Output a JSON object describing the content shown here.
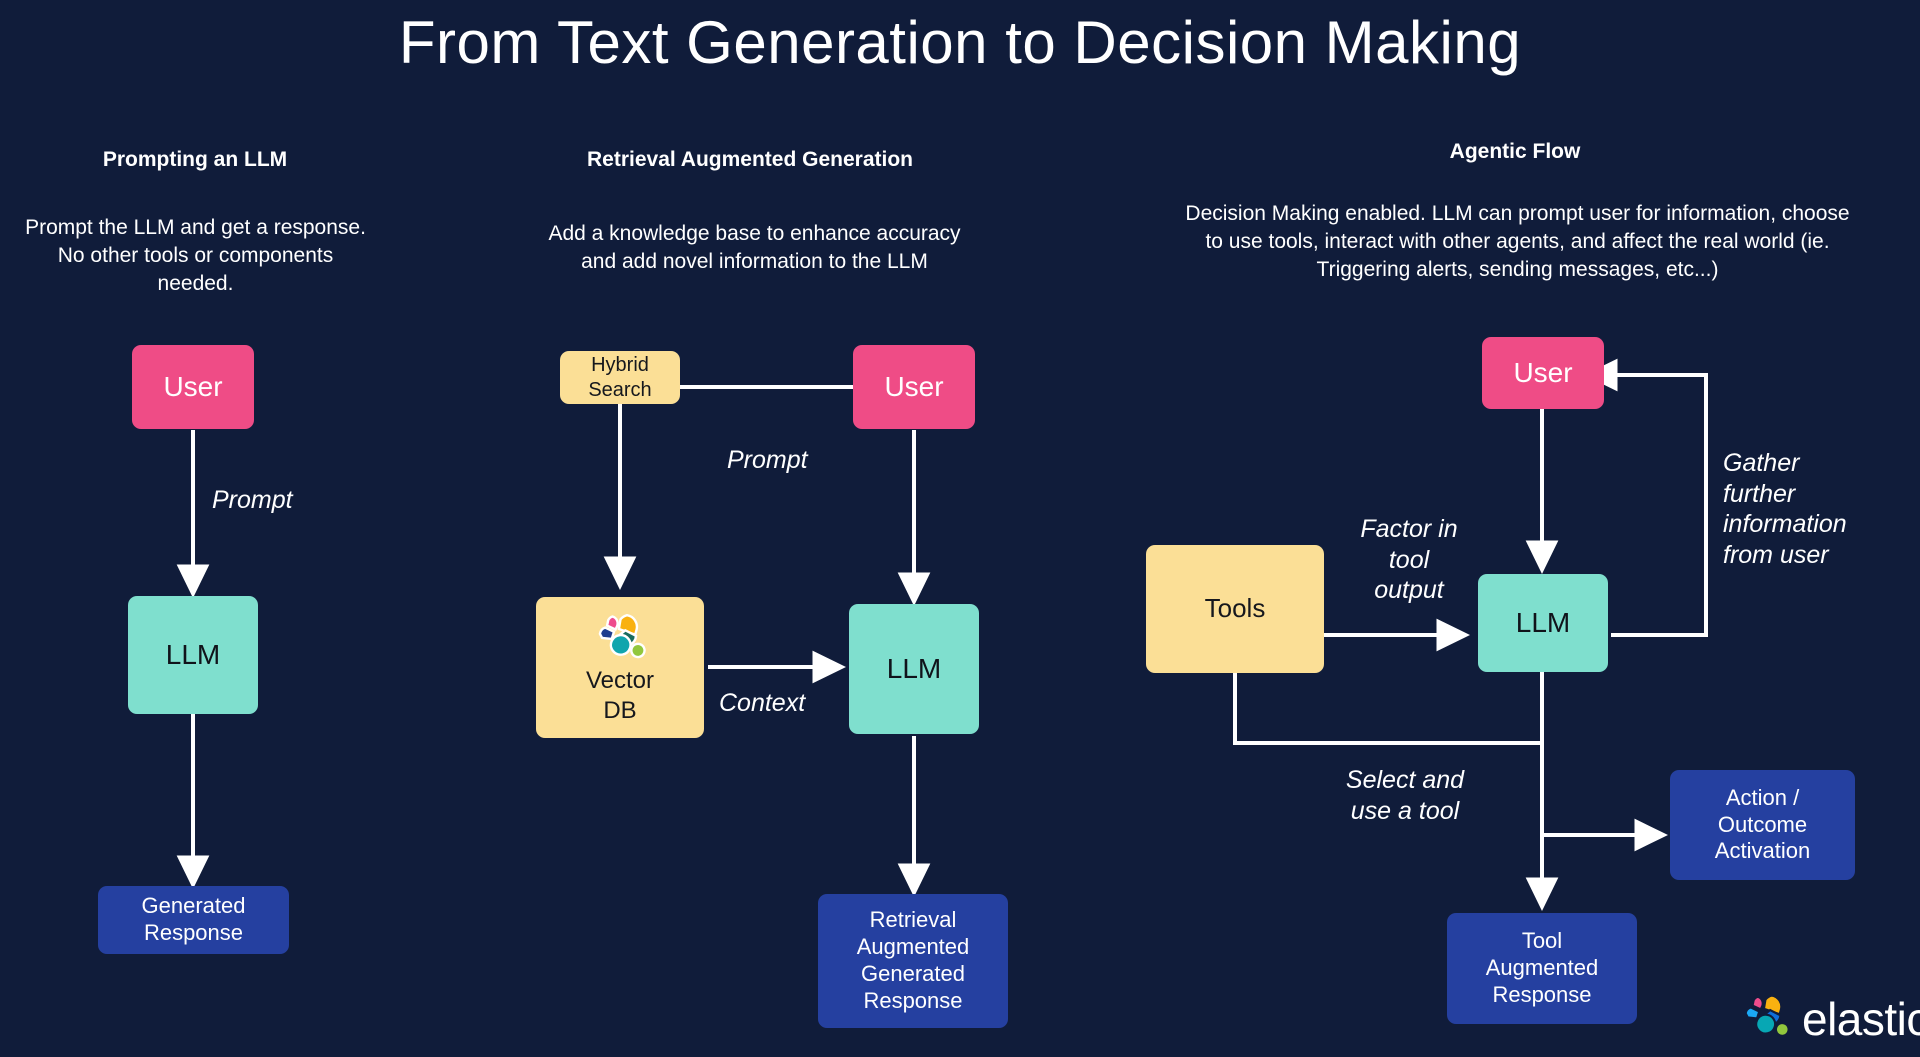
{
  "title": "From Text Generation to Decision Making",
  "colors": {
    "background": "#101c3a",
    "user": "#ef4c86",
    "llm": "#7fdfce",
    "tool": "#fbdf96",
    "response": "#2540a0",
    "edge": "#ffffff"
  },
  "columns": [
    {
      "id": "prompting",
      "heading": "Prompting an LLM",
      "description": "Prompt the LLM and get a response. No other tools or components needed."
    },
    {
      "id": "rag",
      "heading": "Retrieval Augmented Generation",
      "description": "Add a knowledge base to enhance accuracy and add novel information to the LLM"
    },
    {
      "id": "agentic",
      "heading": "Agentic Flow",
      "description": "Decision Making enabled. LLM can prompt user for information, choose to use tools, interact with other agents, and affect the real world (ie. Triggering alerts, sending messages, etc...)"
    }
  ],
  "nodes": {
    "prompting": {
      "user": "User",
      "llm": "LLM",
      "response_line1": "Generated",
      "response_line2": "Response"
    },
    "rag": {
      "hybrid_search_line1": "Hybrid",
      "hybrid_search_line2": "Search",
      "user": "User",
      "vector_db_line1": "Vector",
      "vector_db_line2": "DB",
      "llm": "LLM",
      "response_line1": "Retrieval",
      "response_line2": "Augmented",
      "response_line3": "Generated",
      "response_line4": "Response"
    },
    "agentic": {
      "user": "User",
      "tools": "Tools",
      "llm": "LLM",
      "action_line1": "Action /",
      "action_line2": "Outcome",
      "action_line3": "Activation",
      "tool_response_line1": "Tool",
      "tool_response_line2": "Augmented",
      "tool_response_line3": "Response"
    }
  },
  "edge_labels": {
    "prompting_prompt": "Prompt",
    "rag_prompt": "Prompt",
    "rag_context": "Context",
    "agentic_factor_in_tool_output": "Factor in\ntool\noutput",
    "agentic_gather_further": "Gather\nfurther\ninformation\nfrom user",
    "agentic_select_and_use": "Select and\nuse a tool"
  },
  "brand": {
    "name": "elastic",
    "logo_icon": "elastic-logo-icon",
    "petal_colors": [
      "#ee4c8c",
      "#f9b110",
      "#1ba9f5",
      "#07a7b4",
      "#0f6edb",
      "#92c73d"
    ]
  }
}
